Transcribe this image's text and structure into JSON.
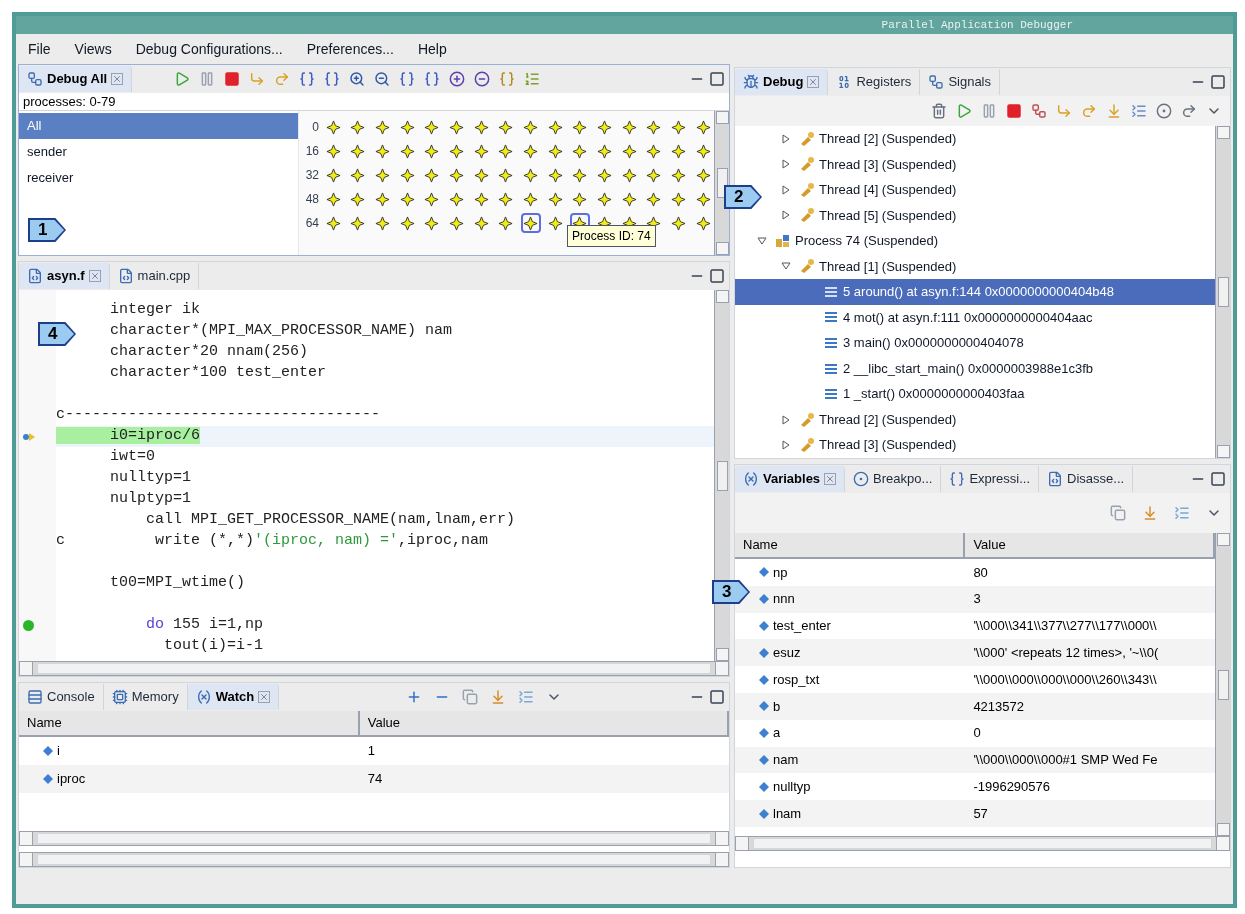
{
  "window": {
    "title": "Parallel Application Debugger"
  },
  "menu": [
    "File",
    "Views",
    "Debug Configurations...",
    "Preferences...",
    "Help"
  ],
  "debug_all": {
    "tab": {
      "label": "Debug All",
      "selected": true
    },
    "range": "processes: 0-79",
    "sets": [
      {
        "label": "All",
        "selected": true
      },
      {
        "label": "sender",
        "selected": false
      },
      {
        "label": "receiver",
        "selected": false
      }
    ],
    "rows": [
      {
        "label": "0",
        "items": [
          {
            "selected": false
          },
          {
            "selected": false
          },
          {
            "selected": false
          },
          {
            "selected": false
          },
          {
            "selected": false
          },
          {
            "selected": false
          },
          {
            "selected": false
          },
          {
            "selected": false
          },
          {
            "selected": false
          },
          {
            "selected": false
          },
          {
            "selected": false
          },
          {
            "selected": false
          },
          {
            "selected": false
          },
          {
            "selected": false
          },
          {
            "selected": false
          },
          {
            "selected": false
          }
        ]
      },
      {
        "label": "16",
        "items": [
          {
            "selected": false
          },
          {
            "selected": false
          },
          {
            "selected": false
          },
          {
            "selected": false
          },
          {
            "selected": false
          },
          {
            "selected": false
          },
          {
            "selected": false
          },
          {
            "selected": false
          },
          {
            "selected": false
          },
          {
            "selected": false
          },
          {
            "selected": false
          },
          {
            "selected": false
          },
          {
            "selected": false
          },
          {
            "selected": false
          },
          {
            "selected": false
          },
          {
            "selected": false
          }
        ]
      },
      {
        "label": "32",
        "items": [
          {
            "selected": false
          },
          {
            "selected": false
          },
          {
            "selected": false
          },
          {
            "selected": false
          },
          {
            "selected": false
          },
          {
            "selected": false
          },
          {
            "selected": false
          },
          {
            "selected": false
          },
          {
            "selected": false
          },
          {
            "selected": false
          },
          {
            "selected": false
          },
          {
            "selected": false
          },
          {
            "selected": false
          },
          {
            "selected": false
          },
          {
            "selected": false
          },
          {
            "selected": false
          }
        ]
      },
      {
        "label": "48",
        "items": [
          {
            "selected": false
          },
          {
            "selected": false
          },
          {
            "selected": false
          },
          {
            "selected": false
          },
          {
            "selected": false
          },
          {
            "selected": false
          },
          {
            "selected": false
          },
          {
            "selected": false
          },
          {
            "selected": false
          },
          {
            "selected": false
          },
          {
            "selected": false
          },
          {
            "selected": false
          },
          {
            "selected": false
          },
          {
            "selected": false
          },
          {
            "selected": false
          },
          {
            "selected": false
          }
        ]
      },
      {
        "label": "64",
        "items": [
          {
            "selected": false
          },
          {
            "selected": false
          },
          {
            "selected": false
          },
          {
            "selected": false
          },
          {
            "selected": false
          },
          {
            "selected": false
          },
          {
            "selected": false
          },
          {
            "selected": false
          },
          {
            "selected": true
          },
          {
            "selected": false
          },
          {
            "selected": true
          },
          {
            "selected": false
          },
          {
            "selected": false
          },
          {
            "selected": false
          },
          {
            "selected": false
          },
          {
            "selected": false
          }
        ]
      }
    ],
    "tooltip": "Process ID: 74"
  },
  "editor": {
    "tabs": [
      {
        "label": "asyn.f",
        "selected": true
      },
      {
        "label": "main.cpp",
        "selected": false
      }
    ],
    "lines": [
      {
        "kind": "code",
        "breakpoint": false,
        "current": false,
        "highlighted": false,
        "parts": [
          {
            "text": "      integer ik",
            "kind": "plain"
          }
        ]
      },
      {
        "kind": "code",
        "breakpoint": false,
        "current": false,
        "highlighted": false,
        "parts": [
          {
            "text": "      character*(MPI_MAX_PROCESSOR_NAME) nam",
            "kind": "plain"
          }
        ]
      },
      {
        "kind": "code",
        "breakpoint": false,
        "current": false,
        "highlighted": false,
        "parts": [
          {
            "text": "      character*20 nnam(256)",
            "kind": "plain"
          }
        ]
      },
      {
        "kind": "code",
        "breakpoint": false,
        "current": false,
        "highlighted": false,
        "parts": [
          {
            "text": "      character*100 test_enter",
            "kind": "plain"
          }
        ]
      },
      {
        "kind": "blank"
      },
      {
        "kind": "code",
        "breakpoint": false,
        "current": false,
        "highlighted": false,
        "parts": [
          {
            "text": "c-----------------------------------",
            "kind": "plain"
          }
        ]
      },
      {
        "kind": "code",
        "breakpoint": false,
        "current": true,
        "highlighted": true,
        "parts": [
          {
            "text": "      i0=iproc/6",
            "kind": "plain"
          }
        ]
      },
      {
        "kind": "code",
        "breakpoint": false,
        "current": false,
        "highlighted": false,
        "parts": [
          {
            "text": "      iwt=0",
            "kind": "plain"
          }
        ]
      },
      {
        "kind": "code",
        "breakpoint": false,
        "current": false,
        "highlighted": false,
        "parts": [
          {
            "text": "      nulltyp=1",
            "kind": "plain"
          }
        ]
      },
      {
        "kind": "code",
        "breakpoint": false,
        "current": false,
        "highlighted": false,
        "parts": [
          {
            "text": "      nulptyp=1",
            "kind": "plain"
          }
        ]
      },
      {
        "kind": "code",
        "breakpoint": false,
        "current": false,
        "highlighted": false,
        "parts": [
          {
            "text": "          call MPI_GET_PROCESSOR_NAME(nam,lnam,err)",
            "kind": "plain"
          }
        ]
      },
      {
        "kind": "code",
        "breakpoint": false,
        "current": false,
        "highlighted": false,
        "parts": [
          {
            "text": "c          write (*,*)",
            "kind": "plain"
          },
          {
            "text": "'(iproc, nam) ='",
            "kind": "string"
          },
          {
            "text": ",iproc,nam",
            "kind": "plain"
          }
        ]
      },
      {
        "kind": "blank"
      },
      {
        "kind": "code",
        "breakpoint": false,
        "current": false,
        "highlighted": false,
        "parts": [
          {
            "text": "      t00=MPI_wtime()",
            "kind": "plain"
          }
        ]
      },
      {
        "kind": "blank"
      },
      {
        "kind": "code",
        "breakpoint": true,
        "current": false,
        "highlighted": false,
        "parts": [
          {
            "text": "          do",
            "kind": "keyword"
          },
          {
            "text": " 155 i=1,np",
            "kind": "plain"
          }
        ]
      },
      {
        "kind": "code",
        "breakpoint": false,
        "current": false,
        "highlighted": false,
        "parts": [
          {
            "text": "            tout(i)=i-1",
            "kind": "plain"
          }
        ]
      }
    ]
  },
  "watch": {
    "tabs": [
      {
        "label": "Console",
        "selected": false
      },
      {
        "label": "Memory",
        "selected": false
      },
      {
        "label": "Watch",
        "selected": true
      }
    ],
    "columns": [
      "Name",
      "Value"
    ],
    "rows": [
      {
        "name": "i",
        "value": "1"
      },
      {
        "name": "iproc",
        "value": "74"
      }
    ]
  },
  "debug": {
    "tabs": [
      {
        "label": "Debug",
        "selected": true
      },
      {
        "label": "Registers",
        "selected": false
      },
      {
        "label": "Signals",
        "selected": false
      }
    ],
    "tree": [
      {
        "kind": "group",
        "children": [
          {
            "kind": "thread",
            "label": "Thread [2] (Suspended)",
            "expanded": false,
            "selected": false
          },
          {
            "kind": "thread",
            "label": "Thread [3] (Suspended)",
            "expanded": false,
            "selected": false
          },
          {
            "kind": "thread",
            "label": "Thread [4] (Suspended)",
            "expanded": false,
            "selected": false
          },
          {
            "kind": "thread",
            "label": "Thread [5] (Suspended)",
            "expanded": false,
            "selected": false
          }
        ]
      },
      {
        "kind": "process",
        "label": "Process 74 (Suspended)",
        "expanded": true,
        "selected": false,
        "children": [
          {
            "kind": "thread",
            "label": "Thread [1] (Suspended)",
            "expanded": true,
            "selected": false,
            "children": [
              {
                "kind": "frame",
                "label": "5 around() at asyn.f:144 0x0000000000404b48",
                "selected": true
              },
              {
                "kind": "frame",
                "label": "4 mot() at asyn.f:111 0x0000000000404aac",
                "selected": false
              },
              {
                "kind": "frame",
                "label": "3 main()  0x0000000000404078",
                "selected": false
              },
              {
                "kind": "frame",
                "label": "2 __libc_start_main()  0x0000003988e1c3fb",
                "selected": false
              },
              {
                "kind": "frame",
                "label": "1 _start()  0x0000000000403faa",
                "selected": false
              }
            ]
          },
          {
            "kind": "thread",
            "label": "Thread [2] (Suspended)",
            "expanded": false,
            "selected": false
          },
          {
            "kind": "thread",
            "label": "Thread [3] (Suspended)",
            "expanded": false,
            "selected": false
          }
        ]
      }
    ]
  },
  "variables": {
    "tabs": [
      {
        "label": "Variables",
        "selected": true
      },
      {
        "label": "Breakpo...",
        "selected": false
      },
      {
        "label": "Expressi...",
        "selected": false
      },
      {
        "label": "Disasse...",
        "selected": false
      }
    ],
    "columns": [
      "Name",
      "Value"
    ],
    "rows": [
      {
        "name": "np",
        "value": "80"
      },
      {
        "name": "nnn",
        "value": "3"
      },
      {
        "name": "test_enter",
        "value": "'\\\\000\\\\341\\\\377\\\\277\\\\177\\\\000\\\\"
      },
      {
        "name": "esuz",
        "value": "'\\\\000' <repeats 12 times>, '~\\\\0("
      },
      {
        "name": "rosp_txt",
        "value": "'\\\\000\\\\000\\\\000\\\\000\\\\260\\\\343\\\\"
      },
      {
        "name": "b",
        "value": "4213572"
      },
      {
        "name": "a",
        "value": "0"
      },
      {
        "name": "nam",
        "value": "'\\\\000\\\\000\\\\000#1 SMP Wed Fe"
      },
      {
        "name": "nulltyp",
        "value": "-1996290576"
      },
      {
        "name": "lnam",
        "value": "57"
      }
    ]
  },
  "callouts": [
    "1",
    "2",
    "3",
    "4"
  ]
}
